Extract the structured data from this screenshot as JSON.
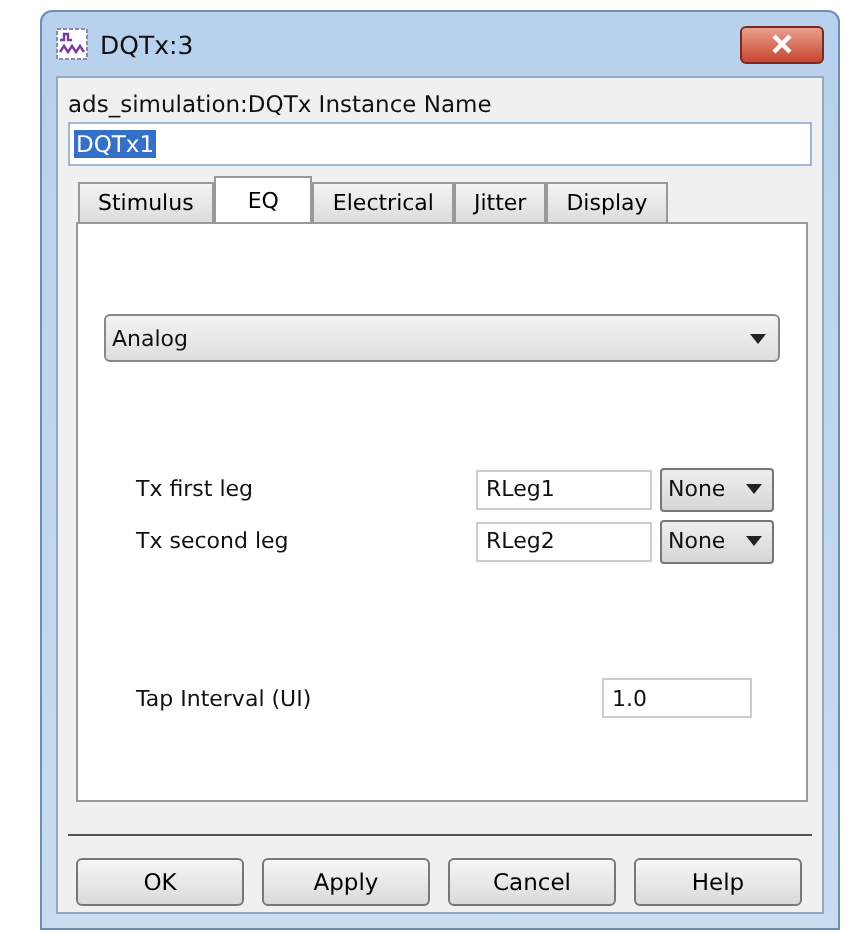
{
  "window": {
    "title": "DQTx:3"
  },
  "instance": {
    "label": "ads_simulation:DQTx Instance Name",
    "value": "DQTx1"
  },
  "tabs": [
    {
      "label": "Stimulus",
      "selected": false
    },
    {
      "label": "EQ",
      "selected": true
    },
    {
      "label": "Electrical",
      "selected": false
    },
    {
      "label": "Jitter",
      "selected": false
    },
    {
      "label": "Display",
      "selected": false
    }
  ],
  "mode": {
    "value": "Analog"
  },
  "legs": [
    {
      "label": "Tx first leg",
      "value": "RLeg1",
      "unit": "None"
    },
    {
      "label": "Tx second leg",
      "value": "RLeg2",
      "unit": "None"
    }
  ],
  "tap_interval": {
    "label": "Tap Interval (UI)",
    "value": "1.0"
  },
  "buttons": [
    "OK",
    "Apply",
    "Cancel",
    "Help"
  ]
}
